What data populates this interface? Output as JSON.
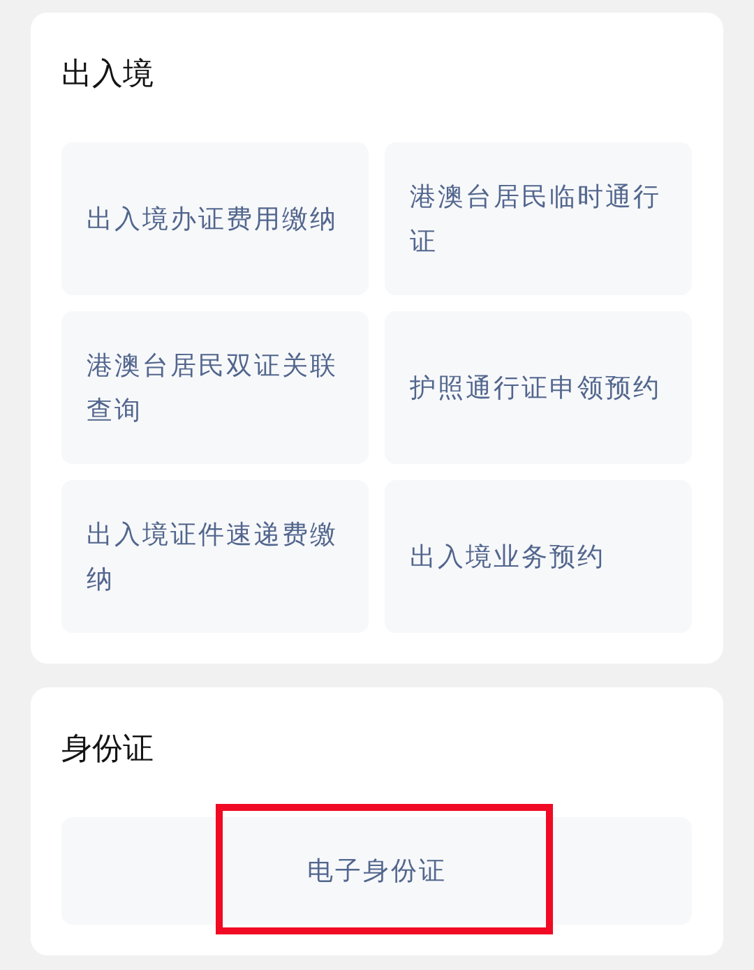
{
  "sections": [
    {
      "kind": "grid",
      "title": "出入境",
      "items": [
        {
          "label": "出入境办证费用缴纳",
          "highlighted": false
        },
        {
          "label": "港澳台居民临时通行证",
          "highlighted": false
        },
        {
          "label": "港澳台居民双证关联查询",
          "highlighted": false
        },
        {
          "label": "护照通行证申领预约",
          "highlighted": false
        },
        {
          "label": "出入境证件速递费缴纳",
          "highlighted": false
        },
        {
          "label": "出入境业务预约",
          "highlighted": false
        }
      ]
    },
    {
      "kind": "wide",
      "title": "身份证",
      "items": [
        {
          "label": "电子身份证",
          "highlighted": true
        }
      ]
    }
  ]
}
